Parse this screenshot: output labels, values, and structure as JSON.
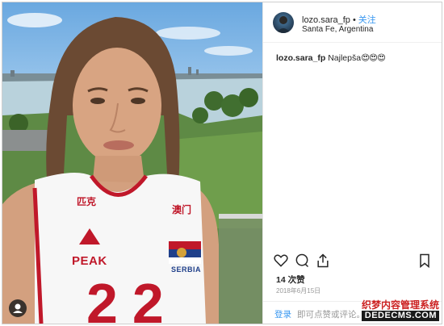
{
  "header": {
    "username": "lozo.sara_fp",
    "dot": "•",
    "follow_label": "关注",
    "location": "Santa Fe, Argentina"
  },
  "caption": {
    "username": "lozo.sara_fp",
    "text": "Najlepša",
    "emojis": "😍😍😍"
  },
  "jersey": {
    "number": "22",
    "brand": "PEAK",
    "country": "SERBIA",
    "sponsor_left": "匹克",
    "sponsor_right": "澳门"
  },
  "actions": {
    "icons": [
      "heart-icon",
      "comment-icon",
      "share-icon",
      "bookmark-icon"
    ]
  },
  "likes": "14 次赞",
  "date": "2018年6月15日",
  "comment_bar": {
    "login_label": "登录",
    "hint": "即可点赞或评论。"
  },
  "watermark": {
    "top": "织梦内容管理系统",
    "bottom": "DEDECMS.COM"
  },
  "colors": {
    "link_blue": "#3897f0",
    "text_dark": "#262626",
    "muted_gray": "#999999",
    "jersey_red": "#c0182a"
  }
}
